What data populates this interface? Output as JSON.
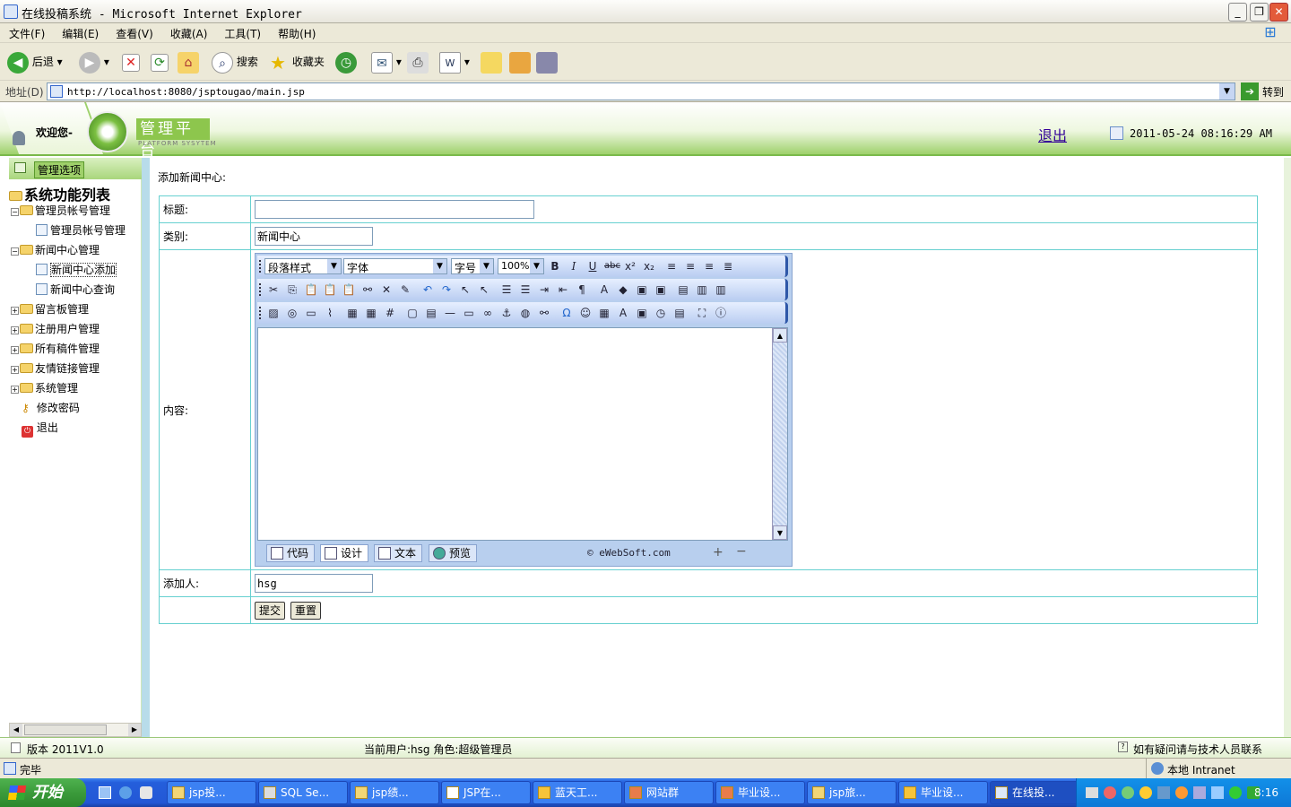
{
  "window": {
    "title": "在线投稿系统 - Microsoft Internet Explorer"
  },
  "menu": [
    "文件(F)",
    "编辑(E)",
    "查看(V)",
    "收藏(A)",
    "工具(T)",
    "帮助(H)"
  ],
  "toolbar": {
    "back": "后退",
    "search": "搜索",
    "favorites": "收藏夹"
  },
  "address": {
    "label": "地址(D)",
    "url": "http://localhost:8080/jsptougao/main.jsp",
    "go": "转到"
  },
  "header": {
    "welcome": "欢迎您-",
    "logo_title": "管理平台",
    "logo_sub": "PLATFORM SYSYTEM",
    "logout": "退出",
    "datetime": "2011-05-24 08:16:29 AM"
  },
  "sidebar": {
    "head": "管理选项",
    "root": "系统功能列表",
    "items": [
      {
        "label": "管理员帐号管理"
      },
      {
        "label": "管理员帐号管理"
      },
      {
        "label": "新闻中心管理"
      },
      {
        "label": "新闻中心添加"
      },
      {
        "label": "新闻中心查询"
      },
      {
        "label": "留言板管理"
      },
      {
        "label": "注册用户管理"
      },
      {
        "label": "所有稿件管理"
      },
      {
        "label": "友情链接管理"
      },
      {
        "label": "系统管理"
      },
      {
        "label": "修改密码"
      },
      {
        "label": "退出"
      }
    ]
  },
  "form": {
    "section_title": "添加新闻中心:",
    "title_label": "标题:",
    "title_value": "",
    "category_label": "类别:",
    "category_value": "新闻中心",
    "content_label": "内容:",
    "adder_label": "添加人:",
    "adder_value": "hsg",
    "submit": "提交",
    "reset": "重置"
  },
  "editor": {
    "paragraph": "段落样式",
    "font": "字体",
    "size": "字号",
    "zoom": "100%",
    "tabs": [
      "代码",
      "设计",
      "文本",
      "预览"
    ],
    "credit": "© eWebSoft.com"
  },
  "page_status": {
    "version": "版本 2011V1.0",
    "current_user": "当前用户:hsg  角色:超级管理员",
    "help": "如有疑问请与技术人员联系"
  },
  "ie_status": {
    "left": "完毕",
    "zone": "本地 Intranet"
  },
  "taskbar": {
    "start": "开始",
    "tasks": [
      "jsp投...",
      "SQL Se...",
      "jsp绩...",
      "JSP在...",
      "蓝天工...",
      "网站群",
      "毕业设...",
      "jsp旅...",
      "毕业设...",
      "在线投..."
    ],
    "clock": "8:16"
  }
}
